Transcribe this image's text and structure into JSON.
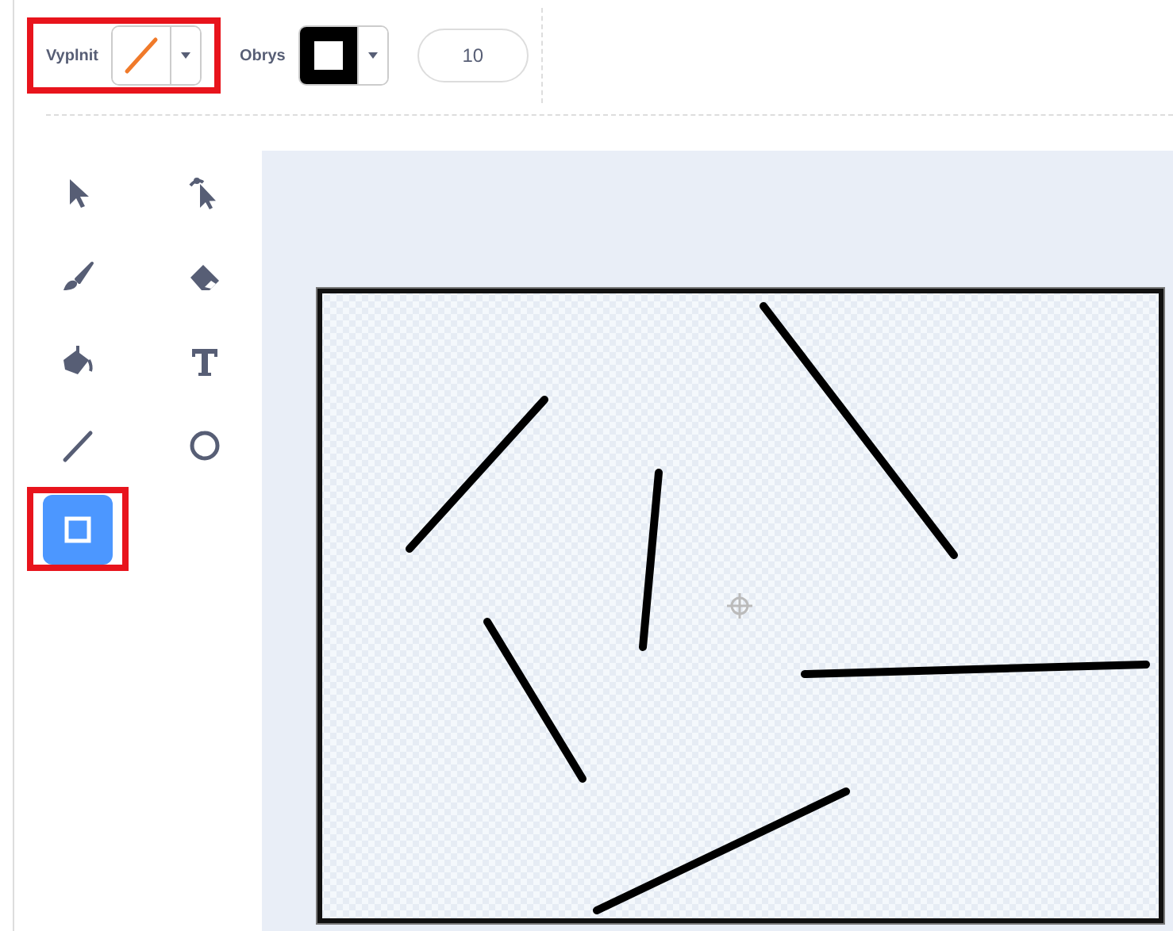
{
  "toolbar": {
    "fill": {
      "label": "Vyplnit",
      "kind": "none",
      "highlighted": true
    },
    "outline": {
      "label": "Obrys",
      "kind": "solid",
      "highlighted": false
    },
    "width": {
      "value": "10"
    }
  },
  "tools": [
    {
      "kind": "select",
      "selected": false,
      "highlighted": false
    },
    {
      "kind": "reshape",
      "selected": false,
      "highlighted": false
    },
    {
      "kind": "brush",
      "selected": false,
      "highlighted": false
    },
    {
      "kind": "eraser",
      "selected": false,
      "highlighted": false
    },
    {
      "kind": "fill",
      "selected": false,
      "highlighted": false
    },
    {
      "kind": "text",
      "selected": false,
      "highlighted": false
    },
    {
      "kind": "line",
      "selected": false,
      "highlighted": false
    },
    {
      "kind": "circle",
      "selected": false,
      "highlighted": false
    },
    {
      "kind": "rectangle",
      "selected": true,
      "highlighted": true
    }
  ]
}
